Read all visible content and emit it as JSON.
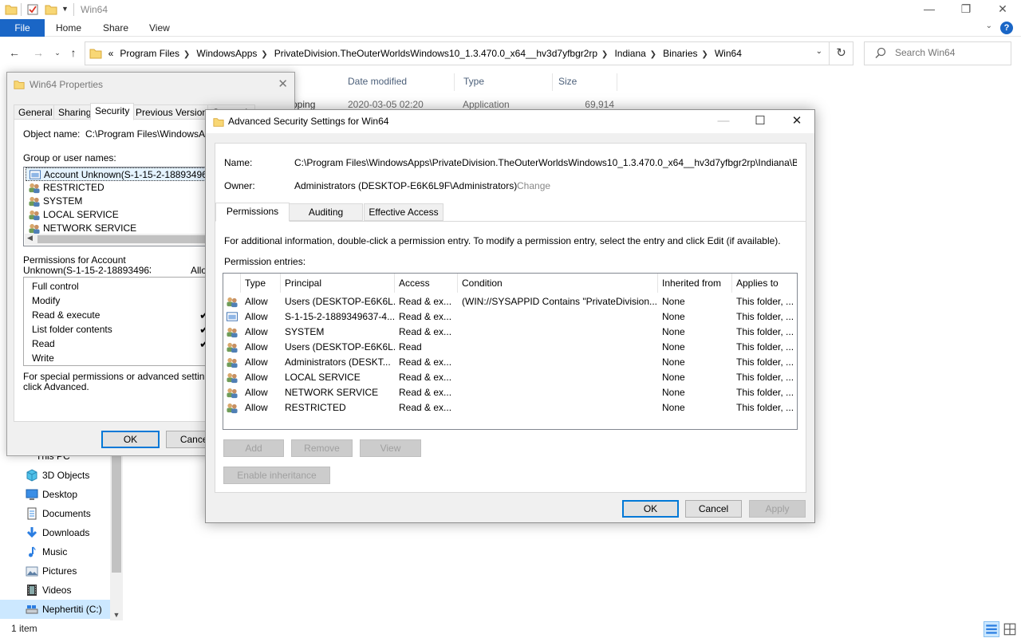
{
  "explorer": {
    "title": "Win64",
    "ribbon": {
      "file": "File",
      "tabs": [
        "Home",
        "Share",
        "View"
      ]
    },
    "address": [
      "Program Files",
      "WindowsApps",
      "PrivateDivision.TheOuterWorldsWindows10_1.3.470.0_x64__hv3d7yfbgr2rp",
      "Indiana",
      "Binaries",
      "Win64"
    ],
    "address_overflow": "«",
    "search_placeholder": "Search Win64",
    "columns": [
      "Date modified",
      "Type",
      "Size"
    ],
    "file": {
      "name_fragment": "pping",
      "date": "2020-03-05 02:20",
      "type": "Application",
      "size": "69,914 KB"
    },
    "sidebar": [
      "This PC",
      "3D Objects",
      "Desktop",
      "Documents",
      "Downloads",
      "Music",
      "Pictures",
      "Videos",
      "Nephertiti (C:)"
    ],
    "status": "1 item"
  },
  "props": {
    "title": "Win64 Properties",
    "tabs": [
      "General",
      "Sharing",
      "Security",
      "Previous Versions",
      "Customize"
    ],
    "object_name_label": "Object name:",
    "object_name_value": "C:\\Program Files\\WindowsApps",
    "group_label": "Group or user names:",
    "users": [
      "Account Unknown(S-1-15-2-1889349637-4",
      "RESTRICTED",
      "SYSTEM",
      "LOCAL SERVICE",
      "NETWORK SERVICE"
    ],
    "perm_for_line1": "Permissions for Account",
    "perm_for_line2": "Unknown(S-1-15-2-1889349637-4",
    "allow_label": "Allow",
    "permissions": [
      {
        "name": "Full control",
        "check": ""
      },
      {
        "name": "Modify",
        "check": ""
      },
      {
        "name": "Read & execute",
        "check": "✔"
      },
      {
        "name": "List folder contents",
        "check": "✔"
      },
      {
        "name": "Read",
        "check": "✔"
      },
      {
        "name": "Write",
        "check": ""
      }
    ],
    "special_line1": "For special permissions or advanced settings,",
    "special_line2": "click Advanced.",
    "ok": "OK",
    "cancel": "Cancel"
  },
  "adv": {
    "title": "Advanced Security Settings for Win64",
    "name_label": "Name:",
    "name_value": "C:\\Program Files\\WindowsApps\\PrivateDivision.TheOuterWorldsWindows10_1.3.470.0_x64__hv3d7yfbgr2rp\\Indiana\\Binaries\\Win64",
    "owner_label": "Owner:",
    "owner_value": "Administrators (DESKTOP-E6K6L9F\\Administrators)",
    "change": "Change",
    "tabs": [
      "Permissions",
      "Auditing",
      "Effective Access"
    ],
    "info": "For additional information, double-click a permission entry. To modify a permission entry, select the entry and click Edit (if available).",
    "entries_label": "Permission entries:",
    "headers": [
      "Type",
      "Principal",
      "Access",
      "Condition",
      "Inherited from",
      "Applies to"
    ],
    "rows": [
      {
        "type": "Allow",
        "principal": "Users (DESKTOP-E6K6L...",
        "access": "Read & ex...",
        "condition": "(WIN://SYSAPPID Contains \"PrivateDivision...",
        "inherited": "None",
        "applies": "This folder, ...",
        "icon": "group"
      },
      {
        "type": "Allow",
        "principal": "S-1-15-2-1889349637-4...",
        "access": "Read & ex...",
        "condition": "",
        "inherited": "None",
        "applies": "This folder, ...",
        "icon": "app"
      },
      {
        "type": "Allow",
        "principal": "SYSTEM",
        "access": "Read & ex...",
        "condition": "",
        "inherited": "None",
        "applies": "This folder, ...",
        "icon": "group"
      },
      {
        "type": "Allow",
        "principal": "Users (DESKTOP-E6K6L...",
        "access": "Read",
        "condition": "",
        "inherited": "None",
        "applies": "This folder, ...",
        "icon": "group"
      },
      {
        "type": "Allow",
        "principal": "Administrators (DESKT...",
        "access": "Read & ex...",
        "condition": "",
        "inherited": "None",
        "applies": "This folder, ...",
        "icon": "group"
      },
      {
        "type": "Allow",
        "principal": "LOCAL SERVICE",
        "access": "Read & ex...",
        "condition": "",
        "inherited": "None",
        "applies": "This folder, ...",
        "icon": "group"
      },
      {
        "type": "Allow",
        "principal": "NETWORK SERVICE",
        "access": "Read & ex...",
        "condition": "",
        "inherited": "None",
        "applies": "This folder, ...",
        "icon": "group"
      },
      {
        "type": "Allow",
        "principal": "RESTRICTED",
        "access": "Read & ex...",
        "condition": "",
        "inherited": "None",
        "applies": "This folder, ...",
        "icon": "group"
      }
    ],
    "buttons": {
      "add": "Add",
      "remove": "Remove",
      "view": "View",
      "enable_inheritance": "Enable inheritance",
      "ok": "OK",
      "cancel": "Cancel",
      "apply": "Apply"
    }
  },
  "colors": {
    "accent": "#0078d7",
    "file_tab": "#1a66c6",
    "selection": "#cce8ff",
    "folder": "#f8d775"
  }
}
